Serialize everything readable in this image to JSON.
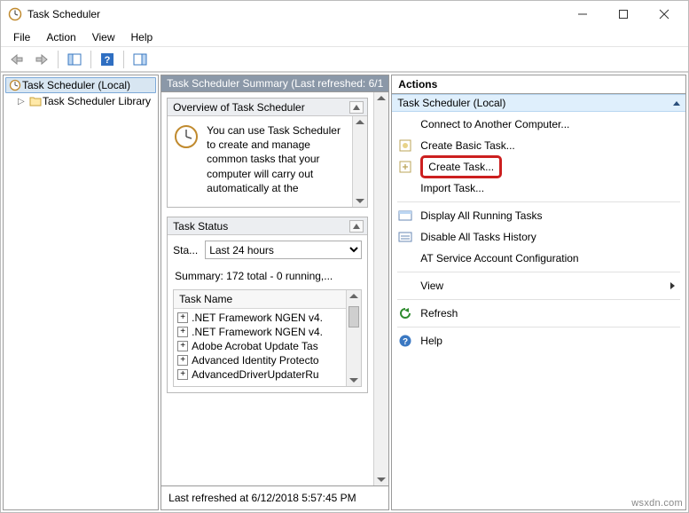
{
  "window": {
    "title": "Task Scheduler"
  },
  "menu": {
    "file": "File",
    "action": "Action",
    "view": "View",
    "help": "Help"
  },
  "tree": {
    "root": "Task Scheduler (Local)",
    "library": "Task Scheduler Library"
  },
  "center": {
    "header": "Task Scheduler Summary (Last refreshed: 6/1",
    "overview": {
      "title": "Overview of Task Scheduler",
      "text": "You can use Task Scheduler to create and manage common tasks that your computer will carry out automatically at the"
    },
    "task_status": {
      "title": "Task Status",
      "label": "Sta...",
      "dropdown_value": "Last 24 hours",
      "summary": "Summary: 172 total - 0 running,..."
    },
    "task_list": {
      "header": "Task Name",
      "items": [
        ".NET Framework NGEN v4.",
        ".NET Framework NGEN v4.",
        "Adobe Acrobat Update Tas",
        "Advanced Identity Protecto",
        "AdvancedDriverUpdaterRu"
      ]
    },
    "footer": "Last refreshed at 6/12/2018 5:57:45 PM"
  },
  "actions": {
    "title": "Actions",
    "subtitle": "Task Scheduler (Local)",
    "items": [
      {
        "label": "Connect to Another Computer...",
        "icon": "none"
      },
      {
        "label": "Create Basic Task...",
        "icon": "create-basic"
      },
      {
        "label": "Create Task...",
        "icon": "create-task",
        "highlight": true
      },
      {
        "label": "Import Task...",
        "icon": "none"
      },
      {
        "label": "Display All Running Tasks",
        "icon": "running",
        "sep_before": true
      },
      {
        "label": "Disable All Tasks History",
        "icon": "history"
      },
      {
        "label": "AT Service Account Configuration",
        "icon": "none"
      },
      {
        "label": "View",
        "icon": "none",
        "sep_before": true,
        "submenu": true
      },
      {
        "label": "Refresh",
        "icon": "refresh",
        "sep_before": true
      },
      {
        "label": "Help",
        "icon": "help",
        "sep_before": true
      }
    ]
  },
  "watermark": "wsxdn.com"
}
